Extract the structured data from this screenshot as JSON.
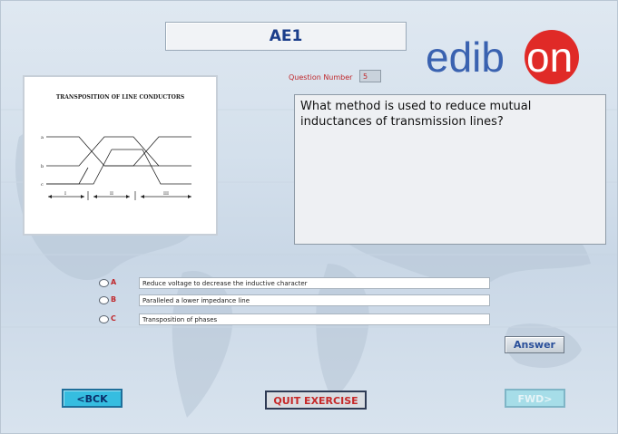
{
  "header": {
    "title": "AE1"
  },
  "brand": {
    "logo_text": "edibon",
    "accent": "#e02a27",
    "text_color": "#3a62b0"
  },
  "question": {
    "number_label": "Question Number",
    "number_value": "5",
    "text": "What method is used to reduce mutual inductances of transmission lines?"
  },
  "figure": {
    "title": "TRANSPOSITION OF LINE CONDUCTORS",
    "row_labels": [
      "a",
      "b",
      "c"
    ],
    "section_labels": [
      "I",
      "II",
      "III"
    ]
  },
  "options": [
    {
      "letter": "A",
      "text": "Reduce voltage to decrease the inductive character"
    },
    {
      "letter": "B",
      "text": "Paralleled a lower impedance line"
    },
    {
      "letter": "C",
      "text": "Transposition of phases"
    }
  ],
  "buttons": {
    "answer": "Answer",
    "back": "<BCK",
    "quit": "QUIT EXERCISE",
    "forward": "FWD>"
  }
}
